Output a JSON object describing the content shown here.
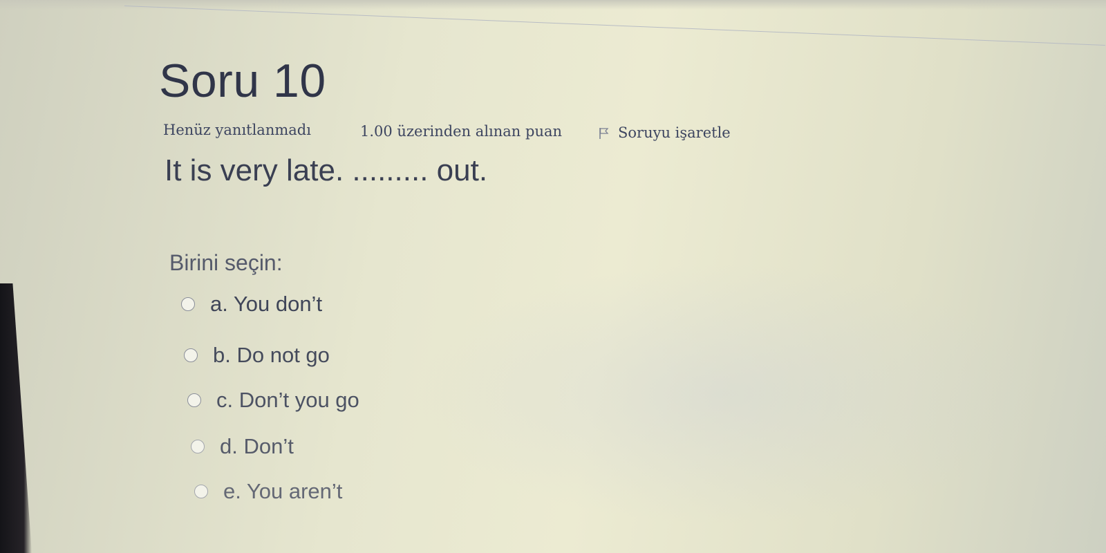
{
  "question": {
    "title": "Soru 10",
    "state": "Henüz yanıtlanmadı",
    "grade": "1.00 üzerinden alınan puan",
    "flag_label": "Soruyu işaretle",
    "flag_icon": "flag-icon",
    "text": "It is very late. ......... out.",
    "prompt": "Birini seçin:"
  },
  "options": [
    {
      "label": "a. You don’t"
    },
    {
      "label": "b. Do not go"
    },
    {
      "label": "c. Don’t you go"
    },
    {
      "label": "d. Don’t"
    },
    {
      "label": "e. You aren’t"
    }
  ],
  "colors": {
    "text_primary": "#303549",
    "text_info": "#3d4560",
    "background": "#e6e6cf"
  }
}
